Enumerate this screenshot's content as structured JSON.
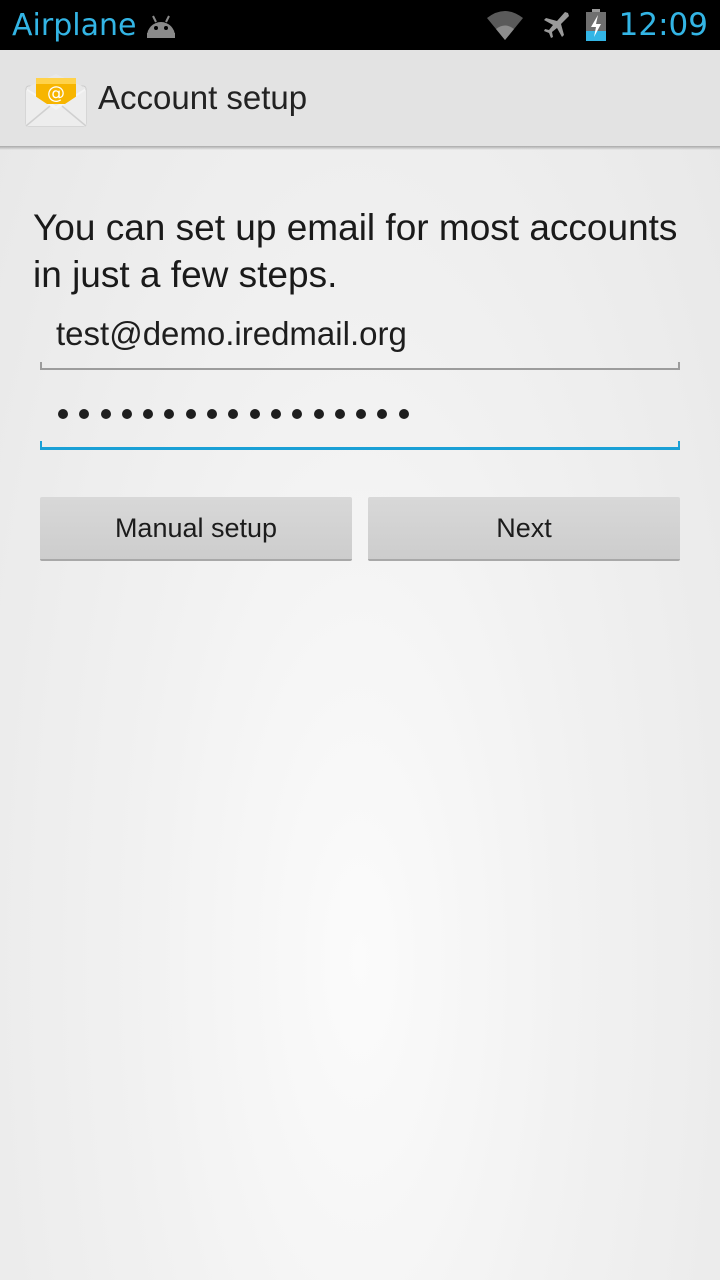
{
  "status_bar": {
    "notice": "Airplane",
    "time": "12:09",
    "icons": [
      "android-icon",
      "wifi-icon",
      "airplane-icon",
      "battery-charging-icon"
    ],
    "accent_color": "#33b5e5"
  },
  "action_bar": {
    "title": "Account setup",
    "icon": "email-app-icon"
  },
  "form": {
    "intro": "You can set up email for most accounts in just a few steps.",
    "email_value": "test@demo.iredmail.org",
    "password_length": 17,
    "focus_color": "#1aa0d6"
  },
  "buttons": {
    "manual_label": "Manual setup",
    "next_label": "Next"
  }
}
